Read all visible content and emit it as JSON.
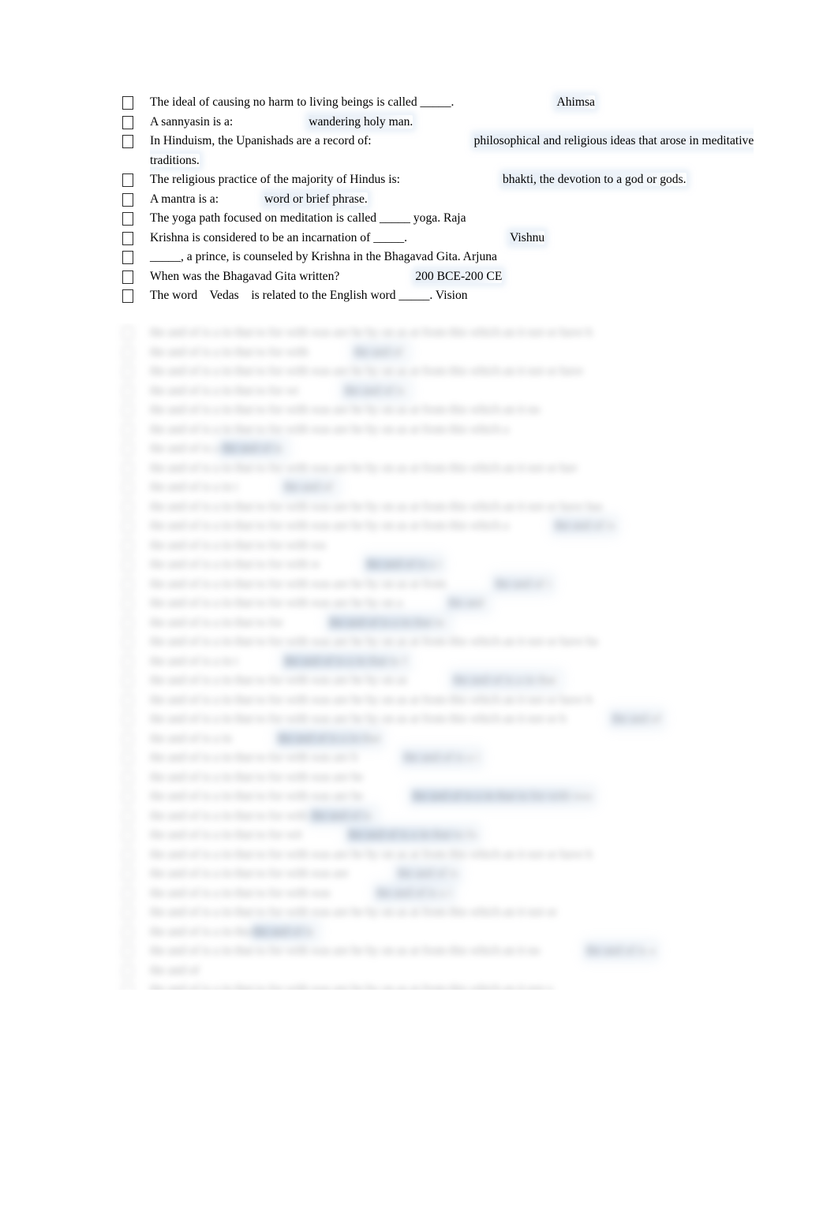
{
  "document": {
    "title": "Hinduism Study Guide",
    "page_background": "#ffffff",
    "text_color": "#000000",
    "highlight_color": "#dce5f0",
    "blur_highlight_color": "#b0c4de",
    "bullet_glyph": "tofu-box",
    "bullet_note": "missing-glyph box rendered in place of list bullet"
  },
  "questions": [
    {
      "bullet": "□",
      "question": "The ideal of causing no harm to living beings is called _____.",
      "gap": "tabgap4",
      "answer": "Ahimsa"
    },
    {
      "bullet": "□",
      "question": "A sannyasin is a:",
      "gap": "tabgap3",
      "answer": "wandering holy man."
    },
    {
      "bullet": "□",
      "question": "In Hinduism, the Upanishads are a record of:",
      "gap": "tabgap4",
      "answer": "philosophical and religious ideas that arose in meditative traditions."
    },
    {
      "bullet": "□",
      "question": "The religious practice of the majority of Hindus is:",
      "gap": "tabgap4",
      "answer": "bhakti, the devotion to a god or gods."
    },
    {
      "bullet": "□",
      "question": "A mantra is a:",
      "gap": "tabgap2",
      "answer": "word or brief phrase."
    },
    {
      "bullet": "□",
      "question": "The yoga path focused on meditation is called _____ yoga. Raja",
      "gap": "",
      "answer": ""
    },
    {
      "bullet": "□",
      "question": "Krishna is considered to be an incarnation of _____.",
      "gap": "tabgap4",
      "answer": "Vishnu"
    },
    {
      "bullet": "□",
      "question": "_____, a prince, is counseled by Krishna in the Bhagavad Gita. Arjuna",
      "gap": "",
      "answer": ""
    },
    {
      "bullet": "□",
      "question": "When was the Bhagavad Gita written?",
      "gap": "tabgap3",
      "answer": "200 BCE-200 CE"
    },
    {
      "bullet": "□",
      "question": "The word    Vedas    is related to the English word _____. Vision",
      "gap": "",
      "answer": ""
    }
  ],
  "redacted_section": {
    "note": "remaining list items are visually blurred / illegible in the screenshot",
    "blur_radius_px": 4.2,
    "line_count": 34,
    "items": [
      {
        "question_width": 620,
        "answer_width": 0,
        "answer_strong": false
      },
      {
        "question_width": 230,
        "answer_width": 70,
        "answer_strong": false
      },
      {
        "question_width": 610,
        "answer_width": 0,
        "answer_strong": false
      },
      {
        "question_width": 215,
        "answer_width": 95,
        "answer_strong": false
      },
      {
        "question_width": 545,
        "answer_width": 0,
        "answer_strong": false
      },
      {
        "question_width": 500,
        "answer_width": 0,
        "answer_strong": false
      },
      {
        "question_width": 105,
        "answer_width": 0,
        "answer_strong": true
      },
      {
        "question_width": 600,
        "answer_width": 0,
        "answer_strong": false
      },
      {
        "question_width": 130,
        "answer_width": 75,
        "answer_strong": false
      },
      {
        "question_width": 640,
        "answer_width": 0,
        "answer_strong": false
      },
      {
        "question_width": 500,
        "answer_width": 85,
        "answer_strong": false
      },
      {
        "question_width": 250,
        "answer_width": 0,
        "answer_strong": false
      },
      {
        "question_width": 245,
        "answer_width": 110,
        "answer_strong": true
      },
      {
        "question_width": 425,
        "answer_width": 80,
        "answer_strong": false
      },
      {
        "question_width": 355,
        "answer_width": 55,
        "answer_strong": false
      },
      {
        "question_width": 195,
        "answer_width": 175,
        "answer_strong": true
      },
      {
        "question_width": 625,
        "answer_width": 0,
        "answer_strong": false
      },
      {
        "question_width": 130,
        "answer_width": 185,
        "answer_strong": true
      },
      {
        "question_width": 360,
        "answer_width": 160,
        "answer_strong": false
      },
      {
        "question_width": 620,
        "answer_width": 0,
        "answer_strong": false
      },
      {
        "question_width": 585,
        "answer_width": 65,
        "answer_strong": false
      },
      {
        "question_width": 120,
        "answer_width": 155,
        "answer_strong": true
      },
      {
        "question_width": 300,
        "answer_width": 110,
        "answer_strong": false
      },
      {
        "question_width": 305,
        "answer_width": 0,
        "answer_strong": false
      },
      {
        "question_width": 310,
        "answer_width": 255,
        "answer_strong": true
      },
      {
        "question_width": 235,
        "answer_width": 0,
        "answer_strong": true
      },
      {
        "question_width": 225,
        "answer_width": 190,
        "answer_strong": true
      },
      {
        "question_width": 620,
        "answer_width": 0,
        "answer_strong": false
      },
      {
        "question_width": 290,
        "answer_width": 85,
        "answer_strong": false
      },
      {
        "question_width": 255,
        "answer_width": 110,
        "answer_strong": false
      },
      {
        "question_width": 580,
        "answer_width": 0,
        "answer_strong": false
      },
      {
        "question_width": 155,
        "answer_width": 0,
        "answer_strong": true
      },
      {
        "question_width": 545,
        "answer_width": 100,
        "answer_strong": false
      },
      {
        "question_width": 70,
        "answer_width": 0,
        "answer_strong": false
      },
      {
        "question_width": 565,
        "answer_width": 0,
        "answer_strong": false
      },
      {
        "question_width": 290,
        "answer_width": 105,
        "answer_strong": false
      }
    ]
  }
}
